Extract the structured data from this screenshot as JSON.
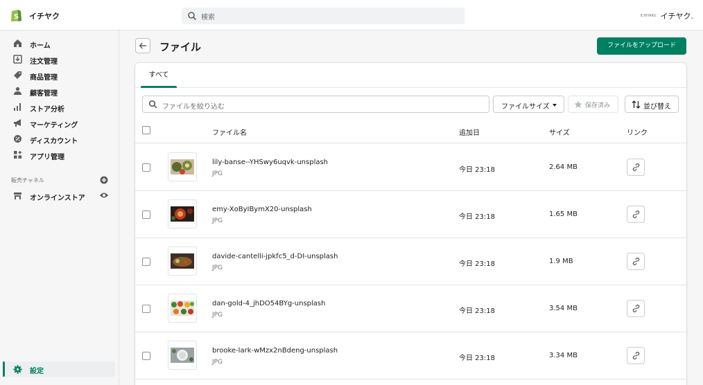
{
  "topbar": {
    "store_name": "イチヤク",
    "search_placeholder": "検索",
    "account_badge": "ICHIYAKU",
    "account_name": "イチヤク."
  },
  "sidebar": {
    "items": [
      {
        "label": "ホーム",
        "icon": "home-icon"
      },
      {
        "label": "注文管理",
        "icon": "orders-icon"
      },
      {
        "label": "商品管理",
        "icon": "tag-icon"
      },
      {
        "label": "顧客管理",
        "icon": "customer-icon"
      },
      {
        "label": "ストア分析",
        "icon": "analytics-icon"
      },
      {
        "label": "マーケティング",
        "icon": "megaphone-icon"
      },
      {
        "label": "ディスカウント",
        "icon": "discount-icon"
      },
      {
        "label": "アプリ管理",
        "icon": "apps-icon"
      }
    ],
    "channels_title": "販売チャネル",
    "online_store_label": "オンラインストア",
    "settings_label": "設定"
  },
  "page": {
    "title": "ファイル",
    "upload_label": "ファイルをアップロード"
  },
  "tabs": [
    "すべて"
  ],
  "filters": {
    "search_placeholder": "ファイルを絞り込む",
    "file_size_label": "ファイルサイズ",
    "saved_label": "保存済み",
    "sort_label": "並び替え"
  },
  "table": {
    "headers": {
      "name": "ファイル名",
      "date": "追加日",
      "size": "サイズ",
      "link": "リンク"
    },
    "rows": [
      {
        "name": "lily-banse--YHSwy6uqvk-unsplash",
        "type": "JPG",
        "date": "今日 23:18",
        "size": "2.64 MB"
      },
      {
        "name": "emy-XoByIBymX20-unsplash",
        "type": "JPG",
        "date": "今日 23:18",
        "size": "1.65 MB"
      },
      {
        "name": "davide-cantelli-jpkfc5_d-DI-unsplash",
        "type": "JPG",
        "date": "今日 23:18",
        "size": "1.9 MB"
      },
      {
        "name": "dan-gold-4_jhDO54BYg-unsplash",
        "type": "JPG",
        "date": "今日 23:18",
        "size": "3.54 MB"
      },
      {
        "name": "brooke-lark-wMzx2nBdeng-unsplash",
        "type": "JPG",
        "date": "今日 23:18",
        "size": "3.34 MB"
      }
    ]
  },
  "colors": {
    "accent": "#008060",
    "text": "#202223",
    "subdued": "#6d7175",
    "border": "#e1e3e5"
  }
}
